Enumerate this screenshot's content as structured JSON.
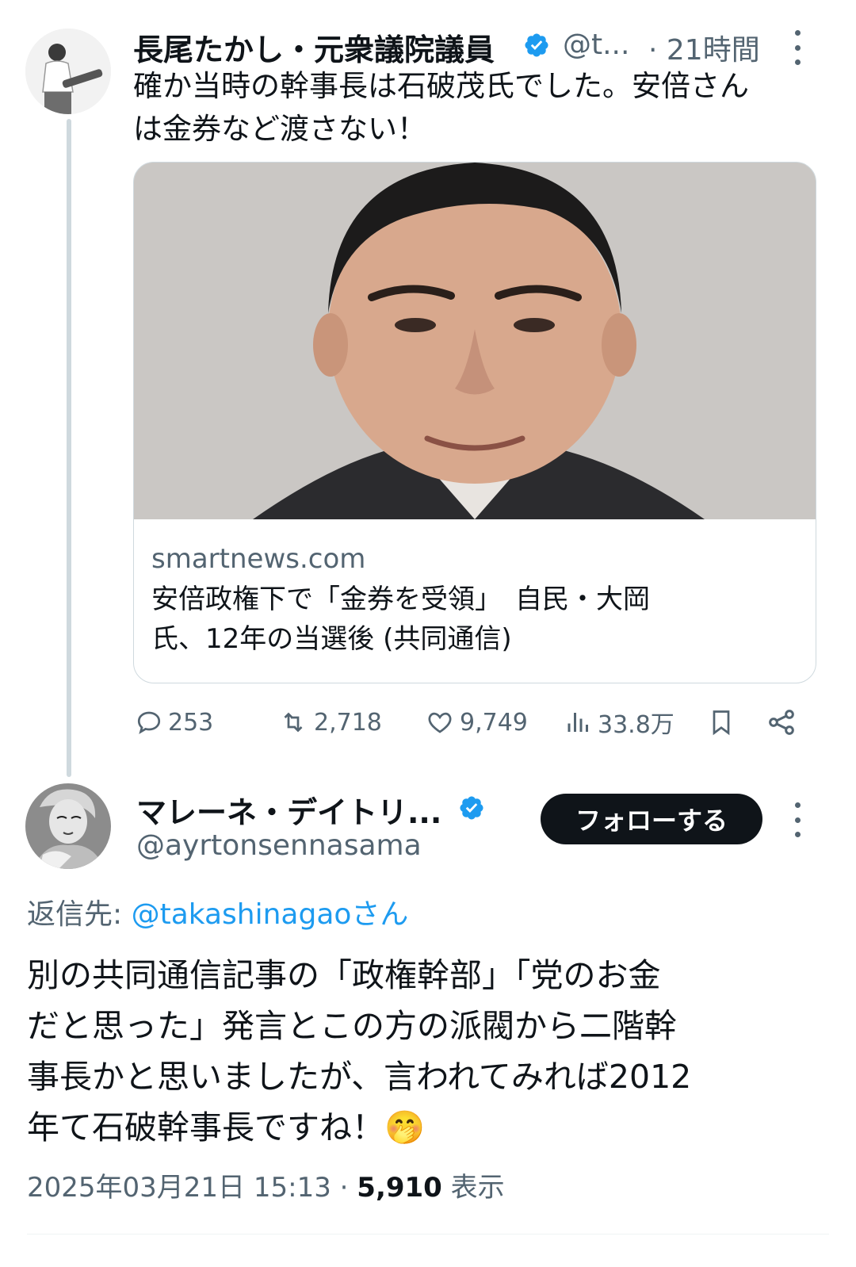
{
  "colors": {
    "accent": "#1d9bf0",
    "text": "#0f1419",
    "muted": "#536471",
    "border": "#cfd9de"
  },
  "quoted_tweet": {
    "author_name": "長尾たかし・元衆議院議員",
    "handle": "@t...",
    "time": "· 21時間",
    "text_line1": "確か当時の幹事長は石破茂氏でした。安倍さん",
    "text_line2": "は金券など渡さない！",
    "card": {
      "domain": "smartnews.com",
      "title_line1": "安倍政権下で「金券を受領」　自民・大岡",
      "title_line2": "氏、12年の当選後 (共同通信)"
    },
    "actions": {
      "replies": "253",
      "reposts": "2,718",
      "likes": "9,749",
      "views": "33.8万"
    },
    "icons": [
      "verified-badge-icon",
      "more-icon",
      "reply-icon",
      "repost-icon",
      "like-icon",
      "views-icon",
      "bookmark-icon",
      "share-icon"
    ]
  },
  "reply_tweet": {
    "author_name": "マレーネ・デイトリ...",
    "handle": "@ayrtonsennasama",
    "follow_label": "フォローする",
    "replying_to_prefix": "返信先:",
    "replying_to_handle": "@takashinagaoさん",
    "text_line1": "別の共同通信記事の「政権幹部」「党のお金",
    "text_line2": "だと思った」発言とこの方の派閥から二階幹",
    "text_line3": "事長かと思いましたが、言われてみれば2012",
    "text_line4": "年て石破幹事長ですね！",
    "emoji": "🤭",
    "timestamp": "2025年03月21日 15:13",
    "dot": "·",
    "view_count": "5,910",
    "view_label": "表示"
  }
}
